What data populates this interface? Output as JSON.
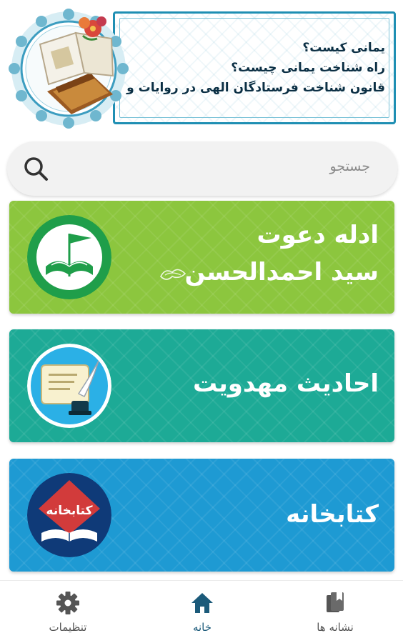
{
  "banner": {
    "lines": [
      "یمانی کیست؟",
      "راه شناخت یمانی چیست؟",
      "قانون شناخت فرستادگان الهی در روایات و قرآن"
    ]
  },
  "search": {
    "placeholder": "جستجو",
    "icon": "search-icon"
  },
  "cards": [
    {
      "title_line1": "ادله دعوت",
      "title_line2": "سید احمدالحسن",
      "color": "#8cc63e",
      "icon": "book-flag-emblem-icon"
    },
    {
      "title": "احادیث مهدویت",
      "color": "#1daa96",
      "icon": "scroll-quill-icon"
    },
    {
      "title": "کتابخانه",
      "color": "#1e9ad3",
      "logo_text": "کتابخانه",
      "icon": "library-book-icon"
    }
  ],
  "bottom_nav": {
    "items": [
      {
        "label": "تنظیمات",
        "icon": "gear-icon"
      },
      {
        "label": "خانه",
        "icon": "home-icon",
        "active": true
      },
      {
        "label": "نشانه ها",
        "icon": "bookmark-icon"
      }
    ],
    "active_color": "#1b5a7a",
    "inactive_color": "#555555"
  }
}
